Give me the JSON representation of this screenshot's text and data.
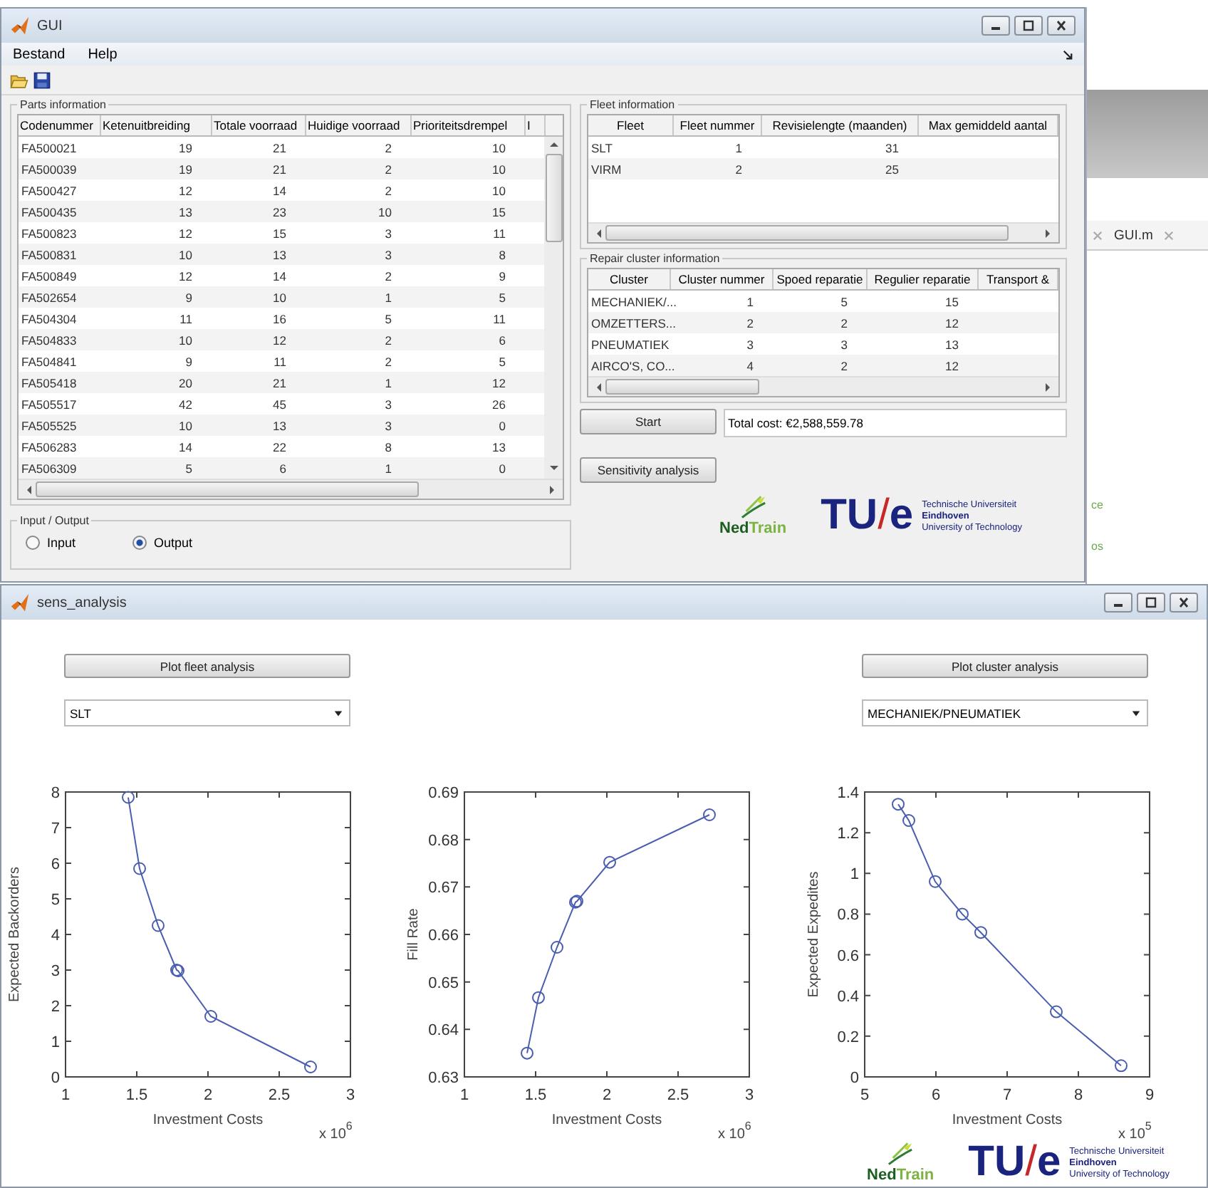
{
  "gui_window": {
    "title": "GUI",
    "menu": [
      "Bestand",
      "Help"
    ],
    "parts_panel": {
      "title": "Parts information",
      "columns": [
        "Codenummer",
        "Ketenuitbreiding",
        "Totale voorraad",
        "Huidige voorraad",
        "Prioriteitsdrempel",
        "I"
      ],
      "rows": [
        [
          "FA500021",
          "19",
          "21",
          "2",
          "10"
        ],
        [
          "FA500039",
          "19",
          "21",
          "2",
          "10"
        ],
        [
          "FA500427",
          "12",
          "14",
          "2",
          "10"
        ],
        [
          "FA500435",
          "13",
          "23",
          "10",
          "15"
        ],
        [
          "FA500823",
          "12",
          "15",
          "3",
          "11"
        ],
        [
          "FA500831",
          "10",
          "13",
          "3",
          "8"
        ],
        [
          "FA500849",
          "12",
          "14",
          "2",
          "9"
        ],
        [
          "FA502654",
          "9",
          "10",
          "1",
          "5"
        ],
        [
          "FA504304",
          "11",
          "16",
          "5",
          "11"
        ],
        [
          "FA504833",
          "10",
          "12",
          "2",
          "6"
        ],
        [
          "FA504841",
          "9",
          "11",
          "2",
          "5"
        ],
        [
          "FA505418",
          "20",
          "21",
          "1",
          "12"
        ],
        [
          "FA505517",
          "42",
          "45",
          "3",
          "26"
        ],
        [
          "FA505525",
          "10",
          "13",
          "3",
          "0"
        ],
        [
          "FA506283",
          "14",
          "22",
          "8",
          "13"
        ],
        [
          "FA506309",
          "5",
          "6",
          "1",
          "0"
        ]
      ]
    },
    "io_panel": {
      "title": "Input / Output",
      "options": [
        {
          "label": "Input",
          "selected": false
        },
        {
          "label": "Output",
          "selected": true
        }
      ]
    },
    "fleet_panel": {
      "title": "Fleet information",
      "columns": [
        "Fleet",
        "Fleet nummer",
        "Revisielengte (maanden)",
        "Max gemiddeld aantal"
      ],
      "rows": [
        [
          "SLT",
          "1",
          "31"
        ],
        [
          "VIRM",
          "2",
          "25"
        ]
      ]
    },
    "cluster_panel": {
      "title": "Repair cluster information",
      "columns": [
        "Cluster",
        "Cluster nummer",
        "Spoed reparatie",
        "Regulier reparatie",
        "Transport &"
      ],
      "rows": [
        [
          "MECHANIEK/...",
          "1",
          "5",
          "15"
        ],
        [
          "OMZETTERS...",
          "2",
          "2",
          "12"
        ],
        [
          "PNEUMATIEK",
          "3",
          "3",
          "13"
        ],
        [
          "AIRCO'S, CO...",
          "4",
          "2",
          "12"
        ]
      ]
    },
    "start_button": "Start",
    "total_cost": "Total cost: €2,588,559.78",
    "sensitivity_button": "Sensitivity analysis",
    "logos": {
      "nedtrain": [
        "Ned",
        "Train"
      ],
      "tue": [
        "TU",
        "/",
        "e"
      ],
      "tue_lines": [
        "Technische Universiteit",
        "Eindhoven",
        "University of Technology"
      ]
    }
  },
  "background_editor": {
    "tab": "GUI.m",
    "side_text": [
      "ce",
      "os"
    ]
  },
  "sens_window": {
    "title": "sens_analysis",
    "fleet_button": "Plot fleet analysis",
    "fleet_select": "SLT",
    "cluster_button": "Plot cluster analysis",
    "cluster_select": "MECHANIEK/PNEUMATIEK",
    "charts": [
      {
        "x_multiplier": {
          "base": "x 10",
          "exponent": "6"
        },
        "chart_data": {
          "type": "line",
          "xlabel": "Investment Costs",
          "ylabel": "Expected Backorders",
          "xlim": [
            1,
            3
          ],
          "ylim": [
            0,
            8
          ],
          "xticks": [
            1,
            1.5,
            2,
            2.5,
            3
          ],
          "yticks": [
            0,
            1,
            2,
            3,
            4,
            5,
            6,
            7,
            8
          ],
          "x": [
            1.44,
            1.52,
            1.65,
            1.78,
            1.79,
            2.02,
            2.72
          ],
          "series": [
            {
              "marker": "circle",
              "color": "#4a5eb0",
              "values": [
                7.85,
                5.85,
                4.25,
                3.0,
                2.98,
                1.7,
                0.28
              ]
            }
          ]
        }
      },
      {
        "x_multiplier": {
          "base": "x 10",
          "exponent": "6"
        },
        "chart_data": {
          "type": "line",
          "xlabel": "Investment Costs",
          "ylabel": "Fill Rate",
          "xlim": [
            1,
            3
          ],
          "ylim": [
            0.63,
            0.69
          ],
          "xticks": [
            1,
            1.5,
            2,
            2.5,
            3
          ],
          "yticks": [
            0.63,
            0.64,
            0.65,
            0.66,
            0.67,
            0.68,
            0.69
          ],
          "x": [
            1.44,
            1.52,
            1.65,
            1.78,
            1.79,
            2.02,
            2.72
          ],
          "series": [
            {
              "marker": "circle",
              "color": "#4a5eb0",
              "values": [
                0.635,
                0.6467,
                0.6573,
                0.6668,
                0.667,
                0.6752,
                0.6852
              ]
            }
          ]
        }
      },
      {
        "x_multiplier": {
          "base": "x 10",
          "exponent": "5"
        },
        "chart_data": {
          "type": "line",
          "xlabel": "Investment Costs",
          "ylabel": "Expected Expedites",
          "xlim": [
            5,
            9
          ],
          "ylim": [
            0,
            1.4
          ],
          "xticks": [
            5,
            6,
            7,
            8,
            9
          ],
          "yticks": [
            0,
            0.2,
            0.4,
            0.6,
            0.8,
            1,
            1.2,
            1.4
          ],
          "x": [
            5.47,
            5.62,
            5.99,
            6.37,
            6.63,
            7.69,
            8.6
          ],
          "series": [
            {
              "marker": "circle",
              "color": "#4a5eb0",
              "values": [
                1.34,
                1.26,
                0.96,
                0.8,
                0.71,
                0.32,
                0.055
              ]
            }
          ]
        }
      }
    ],
    "logos": {
      "nedtrain": [
        "Ned",
        "Train"
      ],
      "tue": [
        "TU",
        "/",
        "e"
      ],
      "tue_lines": [
        "Technische Universiteit",
        "Eindhoven",
        "University of Technology"
      ]
    }
  }
}
